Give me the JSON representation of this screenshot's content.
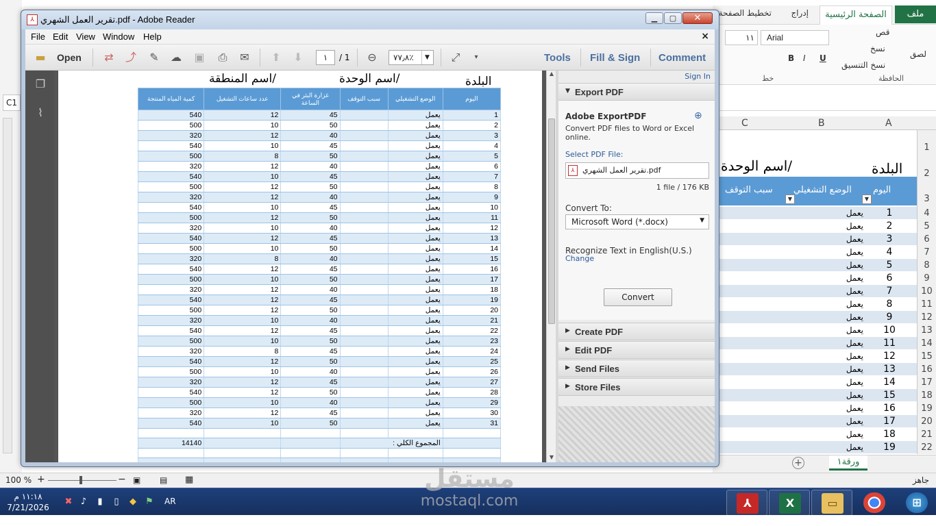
{
  "excel": {
    "file_tab": "ملف",
    "tabs": [
      "الصفحة الرئيسية",
      "إدراج",
      "تخطيط الصفحة"
    ],
    "font_name": "Arial",
    "font_size": "١١",
    "clipboard": {
      "cut": "قص",
      "copy": "نسخ",
      "paste": "لصق",
      "format_painter": "نسخ التنسيق",
      "group": "الحافظة"
    },
    "font_group": "خط",
    "name_box": "C1",
    "columns": [
      "A",
      "B",
      "C"
    ],
    "row_numbers": [
      "1",
      "2",
      "3",
      "4",
      "5",
      "6",
      "7",
      "8",
      "9",
      "10",
      "11",
      "12",
      "13",
      "14",
      "15",
      "16",
      "17",
      "18",
      "19",
      "20",
      "21",
      "22"
    ],
    "title_city": "البلدة",
    "title_unit": "/اسم الوحدة",
    "headers": {
      "day": "اليوم",
      "op_status": "الوضع التشغيلي",
      "stop_reason": "سبب التوقف"
    },
    "rows": [
      {
        "day": "1",
        "status": "يعمل"
      },
      {
        "day": "2",
        "status": "يعمل"
      },
      {
        "day": "3",
        "status": "يعمل"
      },
      {
        "day": "4",
        "status": "يعمل"
      },
      {
        "day": "5",
        "status": "يعمل"
      },
      {
        "day": "6",
        "status": "يعمل"
      },
      {
        "day": "7",
        "status": "يعمل"
      },
      {
        "day": "8",
        "status": "يعمل"
      },
      {
        "day": "9",
        "status": "يعمل"
      },
      {
        "day": "10",
        "status": "يعمل"
      },
      {
        "day": "11",
        "status": "يعمل"
      },
      {
        "day": "12",
        "status": "يعمل"
      },
      {
        "day": "13",
        "status": "يعمل"
      },
      {
        "day": "14",
        "status": "يعمل"
      },
      {
        "day": "15",
        "status": "يعمل"
      },
      {
        "day": "16",
        "status": "يعمل"
      },
      {
        "day": "17",
        "status": "يعمل"
      },
      {
        "day": "18",
        "status": "يعمل"
      },
      {
        "day": "19",
        "status": "يعمل"
      }
    ],
    "sheet_tab": "ورقة١",
    "status_ready": "جاهز",
    "zoom": "100 %"
  },
  "taskbar": {
    "time": "١١:١٨ م",
    "date": "7/21/2026",
    "lang": "AR"
  },
  "watermark": {
    "brand": "مستقل",
    "url": "mostaql.com"
  },
  "reader": {
    "title": "تقرير العمل الشهري.pdf - Adobe Reader",
    "menu": [
      "File",
      "Edit",
      "View",
      "Window",
      "Help"
    ],
    "open_label": "Open",
    "page_current": "١",
    "page_total": "/ 1",
    "zoom": "٧٧٫٨٪",
    "right_tools": {
      "tools": "Tools",
      "fill_sign": "Fill & Sign",
      "comment": "Comment"
    }
  },
  "pdf": {
    "city": "البلدة",
    "unit": "/اسم الوحدة",
    "region": "/اسم المنطقة",
    "headers": {
      "day": "اليوم",
      "op_status": "الوضع التشغيلي",
      "stop_reason": "سبب التوقف",
      "flow_rate": "غزارة البئر في الساعة",
      "hours": "عدد ساعات التشغيل",
      "water_qty": "كمية المياه المنتجة"
    },
    "rows": [
      {
        "day": "1",
        "op": "يعمل",
        "rate": "45",
        "hours": "12",
        "qty": "540"
      },
      {
        "day": "2",
        "op": "يعمل",
        "rate": "50",
        "hours": "10",
        "qty": "500"
      },
      {
        "day": "3",
        "op": "يعمل",
        "rate": "40",
        "hours": "12",
        "qty": "320"
      },
      {
        "day": "4",
        "op": "يعمل",
        "rate": "45",
        "hours": "10",
        "qty": "540"
      },
      {
        "day": "5",
        "op": "يعمل",
        "rate": "50",
        "hours": "8",
        "qty": "500"
      },
      {
        "day": "6",
        "op": "يعمل",
        "rate": "40",
        "hours": "12",
        "qty": "320"
      },
      {
        "day": "7",
        "op": "يعمل",
        "rate": "45",
        "hours": "10",
        "qty": "540"
      },
      {
        "day": "8",
        "op": "يعمل",
        "rate": "50",
        "hours": "12",
        "qty": "500"
      },
      {
        "day": "9",
        "op": "يعمل",
        "rate": "40",
        "hours": "12",
        "qty": "320"
      },
      {
        "day": "10",
        "op": "يعمل",
        "rate": "45",
        "hours": "10",
        "qty": "540"
      },
      {
        "day": "11",
        "op": "يعمل",
        "rate": "50",
        "hours": "12",
        "qty": "500"
      },
      {
        "day": "12",
        "op": "يعمل",
        "rate": "40",
        "hours": "10",
        "qty": "320"
      },
      {
        "day": "13",
        "op": "يعمل",
        "rate": "45",
        "hours": "12",
        "qty": "540"
      },
      {
        "day": "14",
        "op": "يعمل",
        "rate": "50",
        "hours": "10",
        "qty": "500"
      },
      {
        "day": "15",
        "op": "يعمل",
        "rate": "40",
        "hours": "8",
        "qty": "320"
      },
      {
        "day": "16",
        "op": "يعمل",
        "rate": "45",
        "hours": "12",
        "qty": "540"
      },
      {
        "day": "17",
        "op": "يعمل",
        "rate": "50",
        "hours": "10",
        "qty": "500"
      },
      {
        "day": "18",
        "op": "يعمل",
        "rate": "40",
        "hours": "12",
        "qty": "320"
      },
      {
        "day": "19",
        "op": "يعمل",
        "rate": "45",
        "hours": "12",
        "qty": "540"
      },
      {
        "day": "20",
        "op": "يعمل",
        "rate": "50",
        "hours": "12",
        "qty": "500"
      },
      {
        "day": "21",
        "op": "يعمل",
        "rate": "40",
        "hours": "10",
        "qty": "320"
      },
      {
        "day": "22",
        "op": "يعمل",
        "rate": "45",
        "hours": "12",
        "qty": "540"
      },
      {
        "day": "23",
        "op": "يعمل",
        "rate": "50",
        "hours": "10",
        "qty": "500"
      },
      {
        "day": "24",
        "op": "يعمل",
        "rate": "45",
        "hours": "8",
        "qty": "320"
      },
      {
        "day": "25",
        "op": "يعمل",
        "rate": "50",
        "hours": "12",
        "qty": "540"
      },
      {
        "day": "26",
        "op": "يعمل",
        "rate": "40",
        "hours": "10",
        "qty": "500"
      },
      {
        "day": "27",
        "op": "يعمل",
        "rate": "45",
        "hours": "12",
        "qty": "320"
      },
      {
        "day": "28",
        "op": "يعمل",
        "rate": "50",
        "hours": "12",
        "qty": "540"
      },
      {
        "day": "29",
        "op": "يعمل",
        "rate": "40",
        "hours": "10",
        "qty": "500"
      },
      {
        "day": "30",
        "op": "يعمل",
        "rate": "45",
        "hours": "12",
        "qty": "320"
      },
      {
        "day": "31",
        "op": "يعمل",
        "rate": "50",
        "hours": "10",
        "qty": "540"
      }
    ],
    "total_label": "المجموع الكلي :",
    "total_value": "14140"
  },
  "right_pane": {
    "sign_in": "Sign In",
    "export_pdf": "Export PDF",
    "adobe_exportpdf": "Adobe ExportPDF",
    "description": "Convert PDF files to Word or Excel online.",
    "select_pdf_file": "Select PDF File:",
    "file_name": "تقرير العمل الشهري.pdf",
    "file_info": "1 file / 176 KB",
    "convert_to": "Convert To:",
    "format": "Microsoft Word (*.docx)",
    "recognize": "Recognize Text in English(U.S.)",
    "change": "Change",
    "convert_button": "Convert",
    "sections": [
      "Create PDF",
      "Edit PDF",
      "Send Files",
      "Store Files"
    ]
  }
}
